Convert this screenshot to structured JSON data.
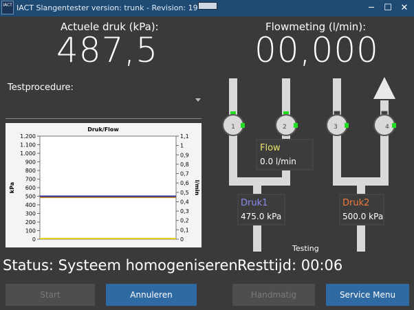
{
  "window": {
    "logo_text": "IACT",
    "title": "IACT Slangentester version: trunk - Revision: 19",
    "minimize": "─",
    "maximize": "☐",
    "close": "✕"
  },
  "pressure": {
    "label": "Actuele druk (kPa):",
    "value": "487,5"
  },
  "flow": {
    "label": "Flowmeting (l/min):",
    "value": "00,000"
  },
  "testprocedure": {
    "label": "Testprocedure:",
    "selected": ""
  },
  "chart_data": {
    "type": "line",
    "title": "Druk/Flow",
    "ylabel": "kPa",
    "y2label": "l/min",
    "ylim": [
      0,
      1200
    ],
    "y2lim": [
      0,
      1.1
    ],
    "yticks": [
      "0",
      "100",
      "200",
      "300",
      "400",
      "500",
      "600",
      "700",
      "800",
      "900",
      "1.000",
      "1.100",
      "1.200"
    ],
    "y2ticks": [
      "0",
      "0,1",
      "0,2",
      "0,3",
      "0,4",
      "0,5",
      "0,6",
      "0,7",
      "0,8",
      "0,9",
      "1",
      "1,1"
    ],
    "series": [
      {
        "axis": "left",
        "values": [
          487.5,
          487.5
        ],
        "color": "#c98a1e"
      },
      {
        "axis": "left",
        "values": [
          500,
          500
        ],
        "color": "#2d2d9a"
      },
      {
        "axis": "right",
        "values": [
          0,
          0
        ],
        "color": "#e3d21a"
      }
    ]
  },
  "diagram": {
    "valves": [
      "1",
      "2",
      "3",
      "4"
    ],
    "flow_box": {
      "title": "Flow",
      "value": "0.0 l/min",
      "title_color": "#e9e36a"
    },
    "druk1_box": {
      "title": "Druk1",
      "value": "475.0 kPa",
      "title_color": "#8c8cf0"
    },
    "druk2_box": {
      "title": "Druk2",
      "value": "500.0 kPa",
      "title_color": "#f07c3a"
    },
    "status_label": "Testing",
    "pipe_color": "#d9d9d9",
    "indicator_color": "#22dd22"
  },
  "status": {
    "text": "Status: Systeem homogeniseren.",
    "resttijd": "Resttijd: 00:06"
  },
  "buttons": {
    "start": "Start",
    "annuleren": "Annuleren",
    "handmatig": "Handmatig",
    "service": "Service Menu"
  }
}
